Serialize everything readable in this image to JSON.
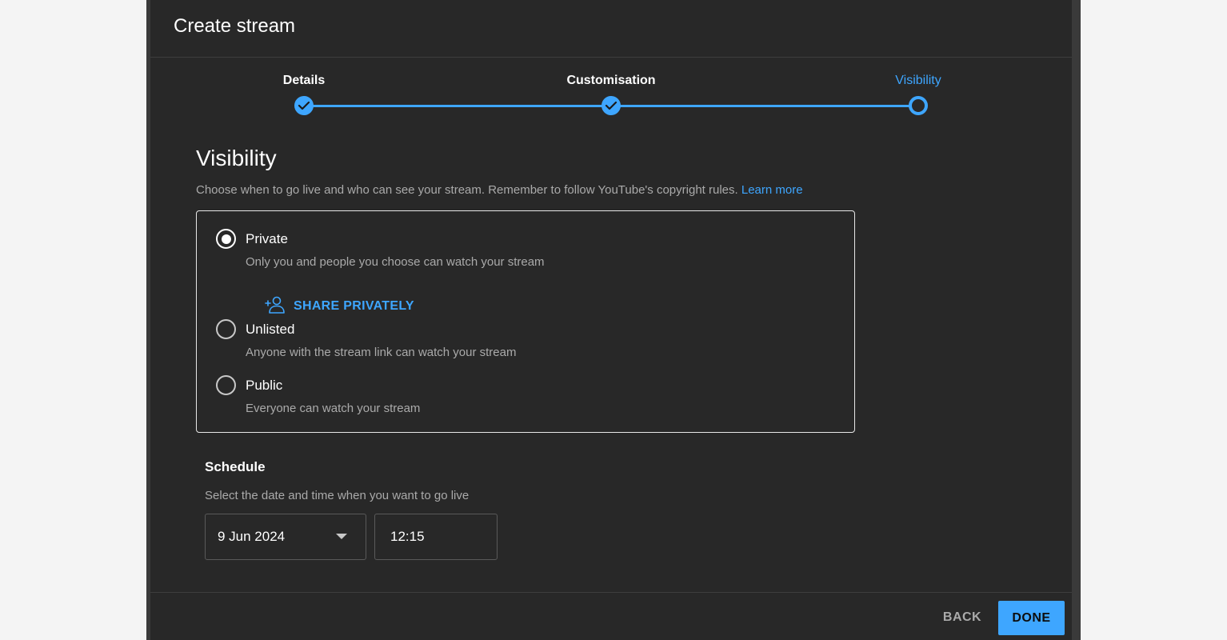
{
  "dialog": {
    "title": "Create stream"
  },
  "stepper": {
    "steps": [
      {
        "label": "Details",
        "state": "done"
      },
      {
        "label": "Customisation",
        "state": "done"
      },
      {
        "label": "Visibility",
        "state": "current"
      }
    ]
  },
  "visibility": {
    "title": "Visibility",
    "description": "Choose when to go live and who can see your stream. Remember to follow YouTube's copyright rules.",
    "learn_more": "Learn more",
    "options": [
      {
        "label": "Private",
        "description": "Only you and people you choose can watch your stream",
        "selected": true
      },
      {
        "label": "Unlisted",
        "description": "Anyone with the stream link can watch your stream",
        "selected": false
      },
      {
        "label": "Public",
        "description": "Everyone can watch your stream",
        "selected": false
      }
    ],
    "share_privately": "SHARE PRIVATELY"
  },
  "schedule": {
    "title": "Schedule",
    "description": "Select the date and time when you want to go live",
    "date": "9 Jun 2024",
    "time": "12:15"
  },
  "footer": {
    "back_label": "BACK",
    "done_label": "DONE"
  },
  "colors": {
    "accent": "#3ea6ff",
    "dialog_bg": "#282828",
    "page_bg": "#f4f4f4"
  }
}
